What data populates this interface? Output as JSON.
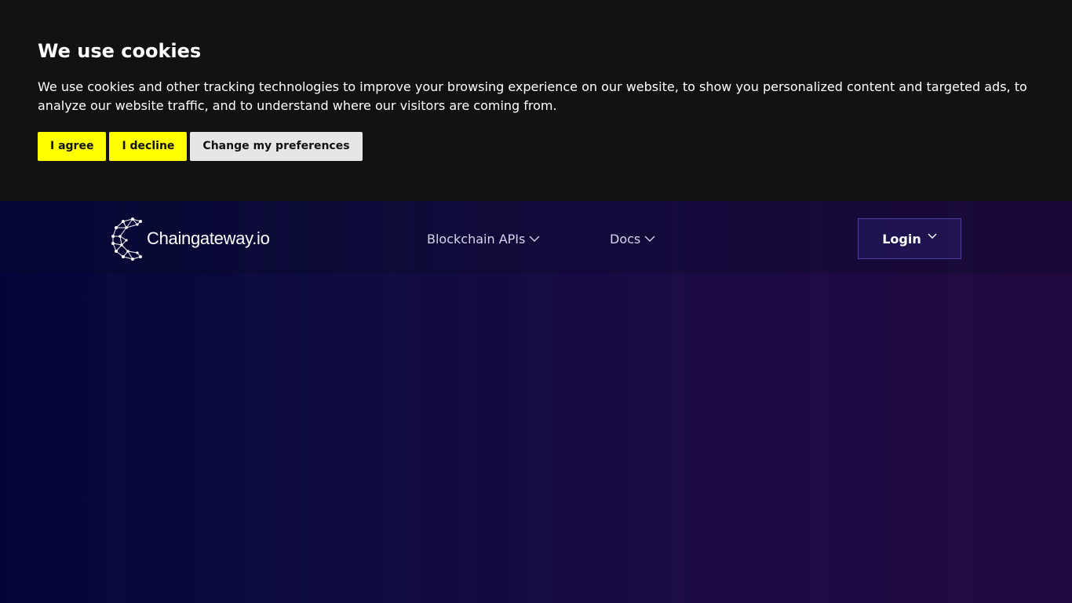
{
  "cookie_banner": {
    "title": "We use cookies",
    "text": "We use cookies and other tracking technologies to improve your browsing experience on our website, to show you personalized content and targeted ads, to analyze our website traffic, and to understand where our visitors are coming from.",
    "buttons": {
      "agree": "I agree",
      "decline": "I decline",
      "preferences": "Change my preferences"
    },
    "colors": {
      "background": "#121212",
      "primary_button": "#ffff00",
      "secondary_button": "#e6e6e6"
    }
  },
  "header": {
    "logo_text": "Chaingateway.io",
    "logo_icon": "network-c-logo-icon",
    "nav": [
      {
        "label": "Blockchain APIs",
        "icon": "chevron-down-icon"
      },
      {
        "label": "Docs",
        "icon": "chevron-down-icon"
      }
    ],
    "login": {
      "label": "Login",
      "icon": "chevron-down-icon"
    }
  },
  "theme": {
    "gradient_start": "#03053a",
    "gradient_end": "#22093f"
  }
}
